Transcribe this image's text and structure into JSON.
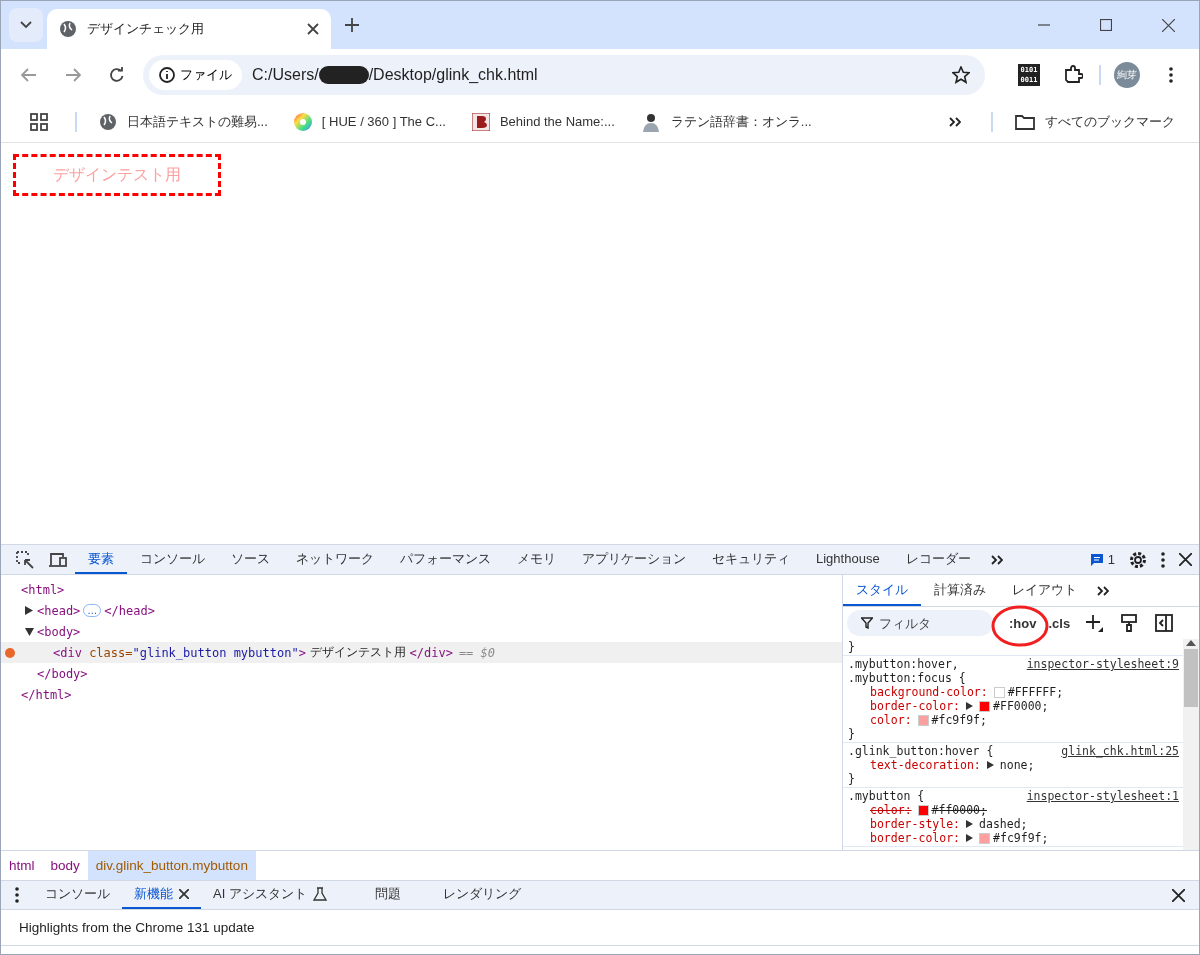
{
  "browser": {
    "tabs": [
      {
        "title": "デザインチェック用",
        "selected": true
      }
    ],
    "address": {
      "chip": "ファイル",
      "url_start": "C:/Users/",
      "url_end": "/Desktop/glink_chk.html",
      "redacted": true
    },
    "extension_label": [
      "0101",
      "0011"
    ],
    "profile": "絢芽",
    "bookmarks": [
      {
        "kind": "globe",
        "label": "日本語テキストの難易..."
      },
      {
        "kind": "wheel",
        "label": "[ HUE / 360 ] The C..."
      },
      {
        "kind": "logo",
        "label": "Behind the Name:..."
      },
      {
        "kind": "photo",
        "label": "ラテン語辞書：オンラ..."
      }
    ],
    "all_bookmarks": "すべてのブックマーク"
  },
  "page": {
    "button_label": "デザインテスト用"
  },
  "devtools": {
    "tabs": [
      {
        "label": "要素",
        "selected": true
      },
      {
        "label": "コンソール",
        "selected": false
      },
      {
        "label": "ソース",
        "selected": false
      },
      {
        "label": "ネットワーク",
        "selected": false
      },
      {
        "label": "パフォーマンス",
        "selected": false
      },
      {
        "label": "メモリ",
        "selected": false
      },
      {
        "label": "アプリケーション",
        "selected": false
      },
      {
        "label": "セキュリティ",
        "selected": false
      },
      {
        "label": "Lighthouse",
        "selected": false
      },
      {
        "label": "レコーダー",
        "selected": false
      }
    ],
    "issues_count": "1",
    "dom": [
      {
        "selected": false,
        "segments": [
          {
            "kind": "tag",
            "text": "<html>"
          }
        ],
        "children": [
          {
            "expanded": false,
            "selected": false,
            "segments": [
              {
                "kind": "tag",
                "text": "<head>"
              },
              {
                "kind": "ellipsis",
                "text": "…"
              },
              {
                "kind": "tag",
                "text": "</head>"
              }
            ]
          },
          {
            "expanded": true,
            "selected": false,
            "segments": [
              {
                "kind": "tag",
                "text": "<body>"
              }
            ],
            "children": [
              {
                "selected": true,
                "segments": [
                  {
                    "kind": "tag",
                    "text": "<div "
                  },
                  {
                    "kind": "attr",
                    "text": "class="
                  },
                  {
                    "kind": "value",
                    "text": "\"glink_button mybutton\""
                  },
                  {
                    "kind": "tag",
                    "text": ">"
                  },
                  {
                    "kind": "text",
                    "text": " デザインテスト用 "
                  },
                  {
                    "kind": "tag",
                    "text": "</div>"
                  },
                  {
                    "kind": "hint",
                    "text": "== $0"
                  }
                ]
              }
            ]
          },
          {
            "selected": false,
            "segments": [
              {
                "kind": "tag",
                "text": "</body>"
              }
            ]
          }
        ]
      },
      {
        "selected": false,
        "segments": [
          {
            "kind": "tag",
            "text": "</html>"
          }
        ]
      }
    ],
    "styles_tabs": [
      {
        "label": "スタイル",
        "selected": true
      },
      {
        "label": "計算済み",
        "selected": false
      },
      {
        "label": "レイアウト",
        "selected": false
      }
    ],
    "filter_placeholder": "フィルタ",
    "hov": ":hov",
    "cls": ".cls",
    "top_fragment": "}",
    "rules": [
      {
        "selectors": [
          ".mybutton:hover,",
          ".mybutton:focus {"
        ],
        "source": "inspector-stylesheet:9",
        "declarations": [
          {
            "prop": "background-color",
            "sep": ":",
            "value": "#FFFFFF;",
            "color": "#ffffff",
            "expander": false,
            "overridden": false
          },
          {
            "prop": "border-color",
            "sep": ":",
            "value": "#FF0000;",
            "color": "#ff0000",
            "expander": true,
            "overridden": false
          },
          {
            "prop": "color",
            "sep": ":",
            "value": "#fc9f9f;",
            "color": "#fc9f9f",
            "expander": false,
            "overridden": false
          }
        ],
        "close": "}"
      },
      {
        "selectors": [
          ".glink_button:hover {"
        ],
        "source": "glink_chk.html:25",
        "declarations": [
          {
            "prop": "text-decoration",
            "sep": ":",
            "value": "none;",
            "expander": true,
            "overridden": false
          }
        ],
        "close": "}"
      },
      {
        "selectors": [
          ".mybutton {"
        ],
        "source": "inspector-stylesheet:1",
        "declarations": [
          {
            "prop": "color",
            "sep": ":",
            "value": "#ff0000;",
            "color": "#ff0000",
            "expander": false,
            "overridden": true
          },
          {
            "prop": "border-style",
            "sep": ":",
            "value": "dashed;",
            "expander": true,
            "overridden": false
          },
          {
            "prop": "border-color",
            "sep": ":",
            "value": "#fc9f9f;",
            "color": "#fc9f9f",
            "expander": true,
            "overridden": false
          }
        ]
      }
    ],
    "breadcrumbs": [
      {
        "label": "html",
        "selected": false
      },
      {
        "label": "body",
        "selected": false
      },
      {
        "label": "div.glink_button.mybutton",
        "selected": true
      }
    ],
    "drawer_tabs": [
      {
        "label": "コンソール",
        "selected": false,
        "kind": "plain"
      },
      {
        "label": "新機能",
        "selected": true,
        "kind": "closable"
      },
      {
        "label": "AI アシスタント",
        "selected": false,
        "kind": "experimental"
      },
      {
        "label": "問題",
        "selected": false,
        "kind": "plain"
      },
      {
        "label": "レンダリング",
        "selected": false,
        "kind": "plain"
      }
    ],
    "drawer_text": "Highlights from the Chrome 131 update"
  }
}
